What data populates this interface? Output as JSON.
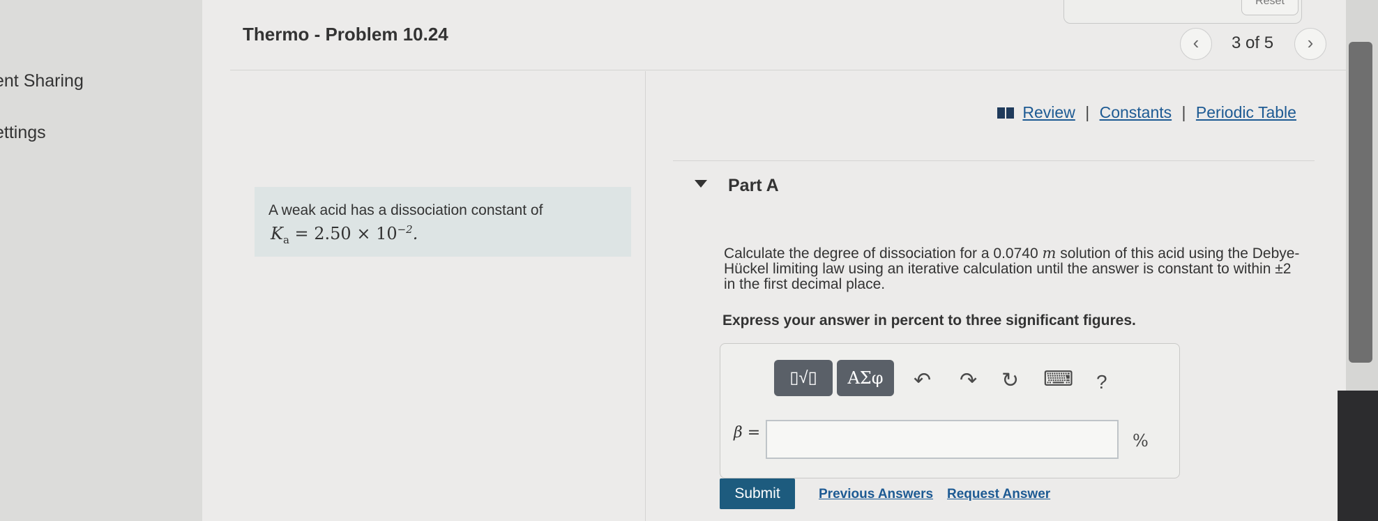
{
  "sidebar": {
    "items": [
      {
        "label": "ent Sharing"
      },
      {
        "label": "ettings"
      }
    ]
  },
  "header": {
    "title": "Thermo - Problem 10.24",
    "reset_label": "Reset",
    "nav": {
      "prev_icon": "chevron-left-icon",
      "next_icon": "chevron-right-icon",
      "position": "3 of 5"
    }
  },
  "resources": {
    "review": "Review",
    "constants": "Constants",
    "periodic_table": "Periodic Table",
    "separator": "|"
  },
  "statement": {
    "text": "A weak acid has a dissociation constant of",
    "math": {
      "symbol": "K",
      "subscript": "a",
      "equals": " = 2.50 × 10",
      "exponent": "−2",
      "end": "."
    }
  },
  "part": {
    "title": "Part A",
    "question_pre": "Calculate the degree of dissociation for a 0.0740 ",
    "question_unit": "m",
    "question_post": " solution of this acid using the Debye-Hückel limiting law using an iterative calculation until the answer is constant to within ±2 in the first decimal place.",
    "instruction": "Express your answer in percent to three significant figures."
  },
  "toolbar": {
    "template_icon": "template-radical-icon",
    "template_label": "▯√▯",
    "greek_label": "ΑΣφ",
    "undo_icon": "undo-icon",
    "undo_glyph": "↶",
    "redo_icon": "redo-icon",
    "redo_glyph": "↷",
    "reset_icon": "reset-icon",
    "reset_glyph": "↻",
    "keyboard_icon": "keyboard-icon",
    "keyboard_glyph": "⌨",
    "help_glyph": "?"
  },
  "answer": {
    "label": "β =",
    "value": "",
    "unit": "%"
  },
  "actions": {
    "submit": "Submit",
    "previous_answers": "Previous Answers",
    "request_answer": "Request Answer"
  }
}
